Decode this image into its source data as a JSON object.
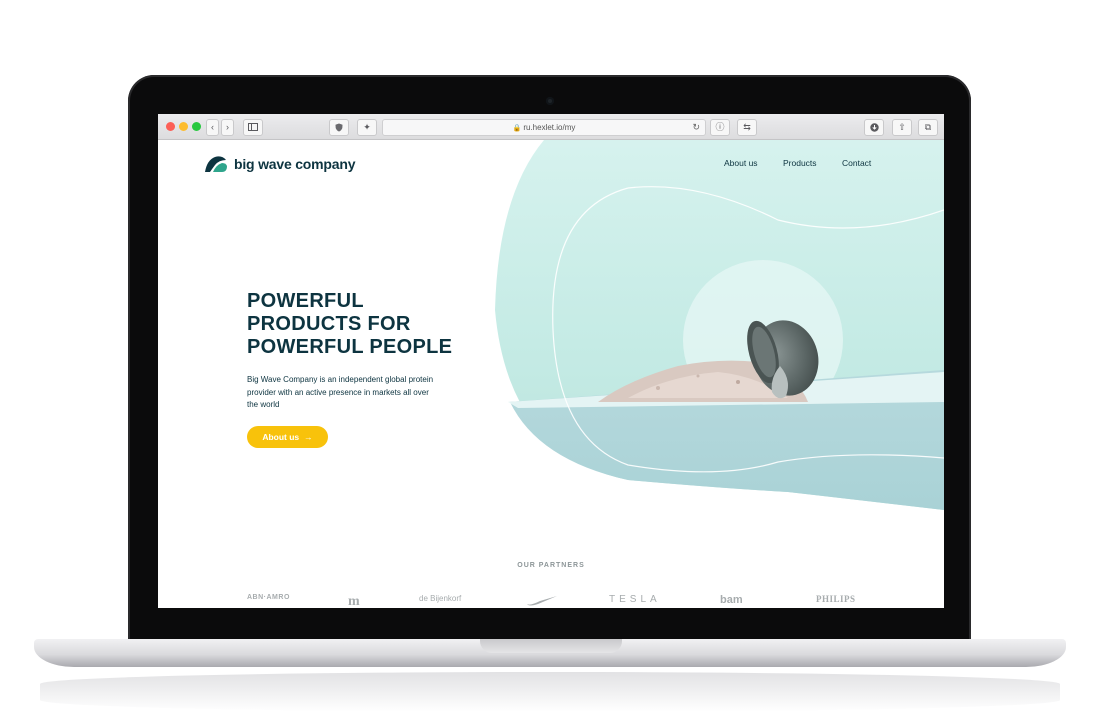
{
  "browser": {
    "url": "ru.hexlet.io/my"
  },
  "site": {
    "logo_text": "big wave company",
    "nav": [
      {
        "label": "About us"
      },
      {
        "label": "Products"
      },
      {
        "label": "Contact"
      }
    ],
    "hero": {
      "title_line1": "POWERFUL",
      "title_line2": "PRODUCTS FOR",
      "title_line3": "POWERFUL PEOPLE",
      "description": "Big Wave Company is an independent global protein provider with an active presence in markets all over the world",
      "cta_label": "About us",
      "cta_arrow": "→"
    },
    "partners": {
      "title": "OUR PARTNERS",
      "logos": [
        "ABN·AMRO",
        "de Bijenkorf",
        "TESLA",
        "bam",
        "PHILIPS"
      ]
    }
  },
  "colors": {
    "brand_dark": "#0d3440",
    "brand_teal": "#2fa58c",
    "accent_yellow": "#f8c20b",
    "mint_bg": "#cdeee8"
  },
  "icons": {
    "back": "chevron-left-icon",
    "forward": "chevron-right-icon",
    "sidebar": "sidebar-icon",
    "shield": "shield-icon",
    "extension": "extension-icon",
    "lock": "lock-icon",
    "reload": "reload-icon",
    "info": "info-icon",
    "translate": "translate-icon",
    "download": "download-icon",
    "share": "share-icon",
    "tabs": "tabs-icon"
  }
}
